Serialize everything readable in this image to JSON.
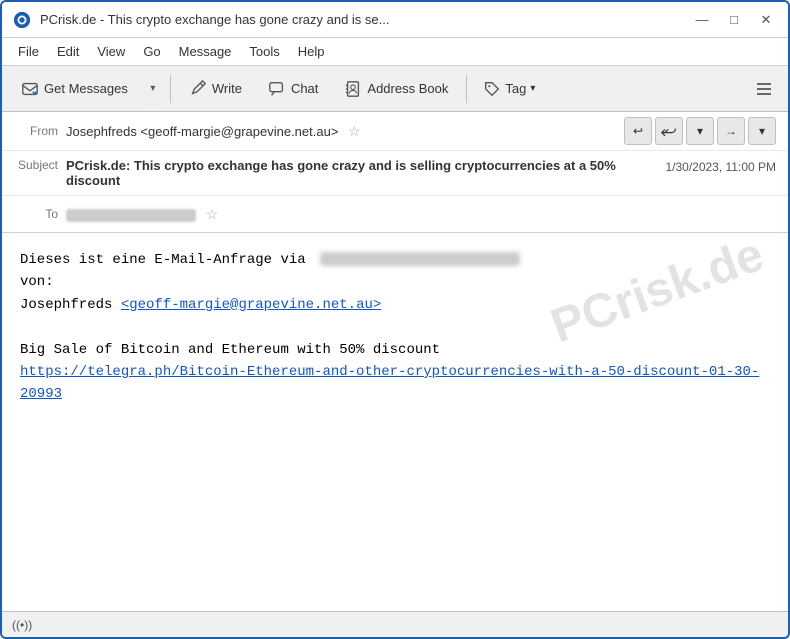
{
  "window": {
    "title": "PCrisk.de - This crypto exchange has gone crazy and is se...",
    "icon": "thunderbird"
  },
  "titlebar": {
    "minimize_label": "—",
    "maximize_label": "□",
    "close_label": "✕"
  },
  "menubar": {
    "items": [
      {
        "id": "file",
        "label": "File"
      },
      {
        "id": "edit",
        "label": "Edit"
      },
      {
        "id": "view",
        "label": "View"
      },
      {
        "id": "go",
        "label": "Go"
      },
      {
        "id": "message",
        "label": "Message"
      },
      {
        "id": "tools",
        "label": "Tools"
      },
      {
        "id": "help",
        "label": "Help"
      }
    ]
  },
  "toolbar": {
    "get_messages_label": "Get Messages",
    "write_label": "Write",
    "chat_label": "Chat",
    "address_book_label": "Address Book",
    "tag_label": "Tag",
    "tag_dropdown": "▾"
  },
  "email_header": {
    "from_label": "From",
    "from_value": "Josephfreds <geoff-margie@grapevine.net.au>",
    "subject_label": "Subject",
    "subject_value": "PCrisk.de: This crypto exchange has gone crazy and is selling cryptocurrencies at a 50% discount",
    "date_value": "1/30/2023, 11:00 PM",
    "to_label": "To",
    "to_placeholder": "[redacted]",
    "actions": {
      "reply": "↩",
      "reply_all": "↩↩",
      "dropdown": "▾",
      "forward": "→",
      "more": "▾"
    }
  },
  "email_body": {
    "line1": "Dieses ist eine E-Mail-Anfrage via",
    "line1_blurred": "[redacted url]",
    "line2": "von:",
    "line3_prefix": "Josephfreds ",
    "line3_link": "<geoff-margie@grapevine.net.au>",
    "line3_link_href": "mailto:geoff-margie@grapevine.net.au",
    "blank": "",
    "line4": "Big Sale of Bitcoin and Ethereum with 50% discount",
    "line5_link": "https://telegra.ph/Bitcoin-Ethereum-and-other-cryptocurrencies-with-a-50-discount-01-30-20993",
    "line5_link_href": "https://telegra.ph/Bitcoin-Ethereum-and-other-cryptocurrencies-with-a-50-discount-01-30-20993",
    "watermark": "PCrisk.de"
  },
  "status_bar": {
    "icon": "((•))",
    "text": ""
  }
}
